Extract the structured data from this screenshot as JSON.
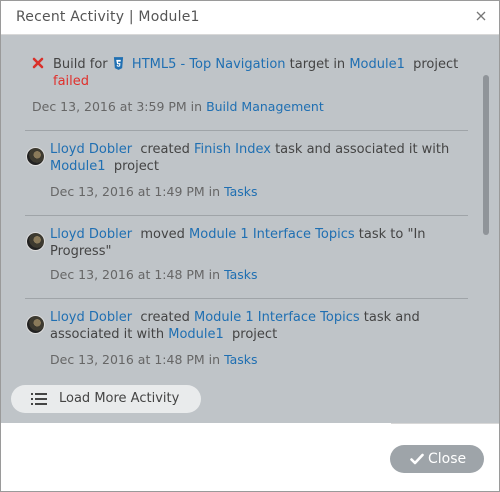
{
  "dialog": {
    "title": "Recent Activity | Module1",
    "close_icon": "close-icon"
  },
  "activities": [
    {
      "status_icon": "error-x-icon",
      "type_icon": "html5-icon",
      "prefix": "Build for",
      "target_link": "HTML5 - Top Navigation",
      "middle": "target in",
      "project_link": "Module1",
      "suffix": "project",
      "status": "failed",
      "date": "Dec 13, 2016 at 3:59 PM in",
      "category_link": "Build Management"
    },
    {
      "user": "Lloyd Dobler",
      "action": "created",
      "task_link": "Finish Index",
      "middle": "task and associated it with",
      "project_link": "Module1",
      "suffix": "project",
      "date": "Dec 13, 2016 at 1:49 PM in",
      "category_link": "Tasks"
    },
    {
      "user": "Lloyd Dobler",
      "action": "moved",
      "task_link": "Module 1 Interface Topics",
      "middle": "task to \"In Progress\"",
      "date": "Dec 13, 2016 at 1:48 PM in",
      "category_link": "Tasks"
    },
    {
      "user": "Lloyd Dobler",
      "action": "created",
      "task_link": "Module 1 Interface Topics",
      "middle_a": "task and",
      "middle_b": "associated it with",
      "project_link": "Module1",
      "suffix": "project",
      "date": "Dec 13, 2016 at 1:48 PM in",
      "category_link": "Tasks"
    }
  ],
  "load_more": {
    "label": "Load More Activity",
    "icon": "list-icon"
  },
  "footer": {
    "close_label": "Close",
    "close_icon": "check-icon"
  },
  "colors": {
    "link": "#1f6fb2",
    "error": "#e0302c",
    "panel": "#bfc4c8"
  }
}
